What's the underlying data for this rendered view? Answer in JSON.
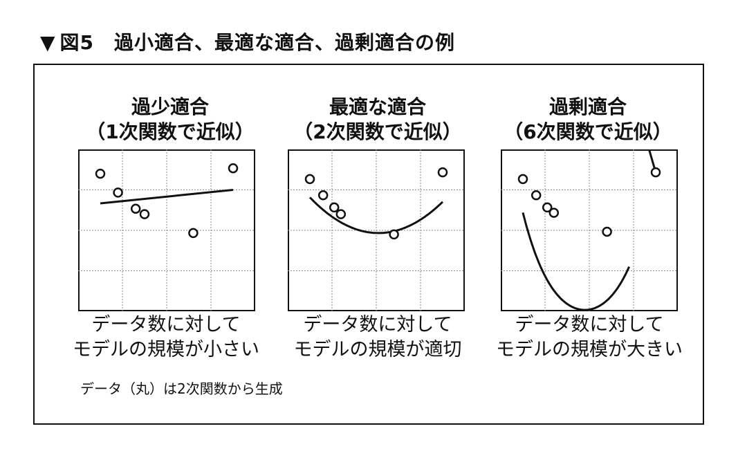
{
  "figure_title": "図5　過小適合、最適な適合、過剰適合の例",
  "triangle_glyph": "▼",
  "panels": [
    {
      "title_line1": "過少適合",
      "title_line2": "（1次関数で近似）",
      "caption_line1": "データ数に対して",
      "caption_line2": "モデルの規模が小さい",
      "points": [
        [
          0.5,
          5.1
        ],
        [
          0.9,
          4.4
        ],
        [
          1.3,
          3.8
        ],
        [
          1.5,
          3.6
        ],
        [
          2.6,
          2.9
        ],
        [
          3.5,
          5.3
        ]
      ],
      "fit_line": [
        [
          0.5,
          4.0
        ],
        [
          3.5,
          4.5
        ]
      ]
    },
    {
      "title_line1": "最適な適合",
      "title_line2": "（2次関数で近似）",
      "caption_line1": "データ数に対して",
      "caption_line2": "モデルの規模が適切",
      "points": [
        [
          0.5,
          4.9
        ],
        [
          0.8,
          4.3
        ],
        [
          1.05,
          3.85
        ],
        [
          1.2,
          3.6
        ],
        [
          2.4,
          2.85
        ],
        [
          3.5,
          5.15
        ]
      ],
      "fit_curve": "quadratic"
    },
    {
      "title_line1": "過剰適合",
      "title_line2": "（6次関数で近似）",
      "caption_line1": "データ数に対して",
      "caption_line2": "モデルの規模が大きい",
      "points": [
        [
          0.5,
          4.9
        ],
        [
          0.8,
          4.3
        ],
        [
          1.05,
          3.85
        ],
        [
          1.2,
          3.65
        ],
        [
          2.4,
          2.95
        ],
        [
          3.5,
          5.15
        ]
      ],
      "fit_curve": "high-order"
    }
  ],
  "footnote": "データ（丸）は2次関数から生成",
  "chart_data": [
    {
      "type": "scatter",
      "title": "過少適合",
      "x": [
        0.5,
        0.9,
        1.3,
        1.5,
        2.6,
        3.5
      ],
      "y": [
        5.1,
        4.4,
        3.8,
        3.6,
        2.9,
        5.3
      ],
      "fit": "linear",
      "grid": true
    },
    {
      "type": "scatter",
      "title": "最適な適合",
      "x": [
        0.5,
        0.8,
        1.05,
        1.2,
        2.4,
        3.5
      ],
      "y": [
        4.9,
        4.3,
        3.85,
        3.6,
        2.85,
        5.15
      ],
      "fit": "quadratic",
      "grid": true
    },
    {
      "type": "scatter",
      "title": "過剰適合",
      "x": [
        0.5,
        0.8,
        1.05,
        1.2,
        2.4,
        3.5
      ],
      "y": [
        4.9,
        4.3,
        3.85,
        3.65,
        2.95,
        5.15
      ],
      "fit": "degree-6",
      "grid": true
    }
  ]
}
